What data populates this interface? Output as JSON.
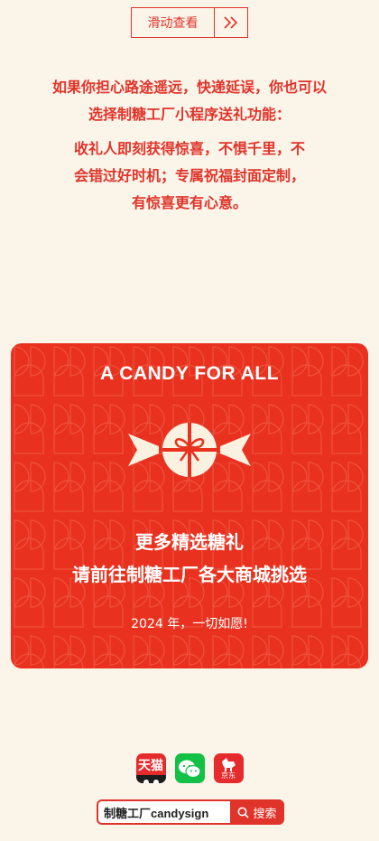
{
  "swipe": {
    "label": "滑动查看",
    "arrow_icon": "double-chevron-right-icon"
  },
  "intro": {
    "line1": "如果你担心路途遥远，快递延误，你也可以",
    "line2": "选择制糖工厂小程序送礼功能：",
    "line3": "收礼人即刻获得惊喜，不惧千里，不",
    "line4": "会错过好时机；专属祝福封面定制，",
    "line5": "有惊喜更有心意。"
  },
  "card": {
    "title": "A CANDY FOR ALL",
    "icon": "candy-gift-icon",
    "line1": "更多精选糖礼",
    "line2": "请前往制糖工厂各大商城挑选",
    "year_note": "2024 年，一切如愿!"
  },
  "stores": [
    {
      "name": "天猫",
      "icon": "tmall-icon"
    },
    {
      "name": "",
      "icon": "wechat-icon"
    },
    {
      "name": "京东",
      "icon": "jd-icon"
    }
  ],
  "search": {
    "query": "制糖工厂candysign",
    "button_label": "搜索",
    "icon": "search-icon"
  },
  "colors": {
    "accent": "#e0342a",
    "background": "#fbf4e9",
    "card": "#e8321f",
    "wechat": "#12c146"
  }
}
